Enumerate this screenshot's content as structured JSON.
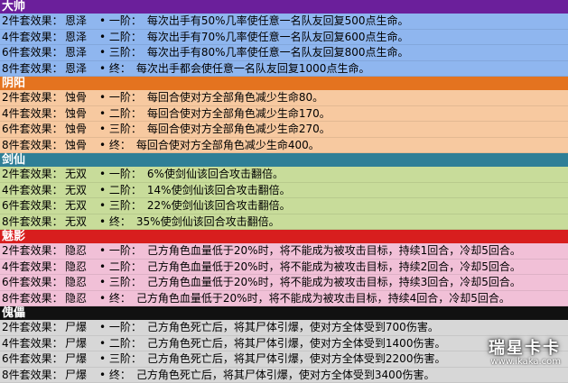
{
  "sections": [
    {
      "title": "大帅",
      "header_color": "#6b1f9b",
      "row_color": "#8fb6ef",
      "rows": [
        {
          "key": "2件套效果：",
          "set": "恩泽",
          "tier": "• 一阶：",
          "text": "每次出手有50%几率使任意一名队友回复500点生命。"
        },
        {
          "key": "4件套效果：",
          "set": "恩泽",
          "tier": "• 二阶：",
          "text": "每次出手有70%几率使任意一名队友回复600点生命。"
        },
        {
          "key": "6件套效果：",
          "set": "恩泽",
          "tier": "• 三阶：",
          "text": "每次出手有80%几率使任意一名队友回复800点生命。"
        },
        {
          "key": "8件套效果：",
          "set": "恩泽",
          "tier": "• 终：",
          "text": "每次出手都会使任意一名队友回复1000点生命。"
        }
      ]
    },
    {
      "title": "阴阳",
      "header_color": "#e4731f",
      "row_color": "#f7c9a0",
      "rows": [
        {
          "key": "2件套效果：",
          "set": "蚀骨",
          "tier": "• 一阶：",
          "text": "每回合使对方全部角色减少生命80。"
        },
        {
          "key": "4件套效果：",
          "set": "蚀骨",
          "tier": "• 二阶：",
          "text": "每回合使对方全部角色减少生命170。"
        },
        {
          "key": "6件套效果：",
          "set": "蚀骨",
          "tier": "• 三阶：",
          "text": "每回合使对方全部角色减少生命270。"
        },
        {
          "key": "8件套效果：",
          "set": "蚀骨",
          "tier": "• 终：",
          "text": "每回合使对方全部角色减少生命400。"
        }
      ]
    },
    {
      "title": "剑仙",
      "header_color": "#2f7f97",
      "row_color": "#c8dc9a",
      "rows": [
        {
          "key": "2件套效果：",
          "set": "无双",
          "tier": "• 一阶：",
          "text": "6%使剑仙该回合攻击翻倍。"
        },
        {
          "key": "4件套效果：",
          "set": "无双",
          "tier": "• 二阶：",
          "text": "14%使剑仙该回合攻击翻倍。"
        },
        {
          "key": "6件套效果：",
          "set": "无双",
          "tier": "• 三阶：",
          "text": "22%使剑仙该回合攻击翻倍。"
        },
        {
          "key": "8件套效果：",
          "set": "无双",
          "tier": "• 终：",
          "text": "35%使剑仙该回合攻击翻倍。"
        }
      ]
    },
    {
      "title": "魅影",
      "header_color": "#d81e1e",
      "row_color": "#f1c0d7",
      "rows": [
        {
          "key": "2件套效果：",
          "set": "隐忍",
          "tier": "• 一阶：",
          "text": "己方角色血量低于20%时，将不能成为被攻击目标，持续1回合，冷却5回合。"
        },
        {
          "key": "4件套效果：",
          "set": "隐忍",
          "tier": "• 二阶：",
          "text": "己方角色血量低于20%时，将不能成为被攻击目标，持续2回合，冷却5回合。"
        },
        {
          "key": "6件套效果：",
          "set": "隐忍",
          "tier": "• 三阶：",
          "text": "己方角色血量低于20%时，将不能成为被攻击目标，持续3回合，冷却5回合。"
        },
        {
          "key": "8件套效果：",
          "set": "隐忍",
          "tier": "• 终：",
          "text": "己方角色血量低于20%时，将不能成为被攻击目标，持续4回合，冷却5回合。"
        }
      ]
    },
    {
      "title": "傀儡",
      "header_color": "#111111",
      "row_color": "#d7d7d7",
      "rows": [
        {
          "key": "2件套效果：",
          "set": "尸爆",
          "tier": "• 一阶：",
          "text": "己方角色死亡后，将其尸体引爆，使对方全体受到700伤害。"
        },
        {
          "key": "4件套效果：",
          "set": "尸爆",
          "tier": "• 二阶：",
          "text": "己方角色死亡后，将其尸体引爆，使对方全体受到1400伤害。"
        },
        {
          "key": "6件套效果：",
          "set": "尸爆",
          "tier": "• 三阶：",
          "text": "己方角色死亡后，将其尸体引爆，使对方全体受到2200伤害。"
        },
        {
          "key": "8件套效果：",
          "set": "尸爆",
          "tier": "• 终：",
          "text": "己方角色死亡后，将其尸体引爆，使对方全体受到3400伤害。"
        }
      ]
    }
  ],
  "watermark": {
    "main": "瑞星卡卡",
    "url": "www.ikaka.com"
  }
}
